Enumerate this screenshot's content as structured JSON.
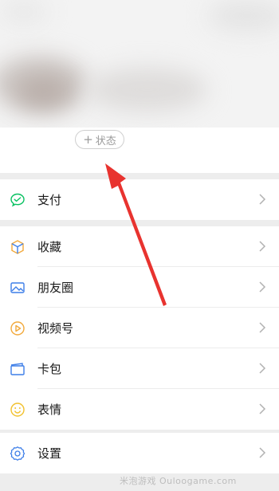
{
  "status": {
    "plus": "+",
    "label": "状态"
  },
  "groups": [
    {
      "items": [
        {
          "label": "支付",
          "icon": "pay-icon"
        }
      ]
    },
    {
      "items": [
        {
          "label": "收藏",
          "icon": "favorites-icon"
        },
        {
          "label": "朋友圈",
          "icon": "moments-icon"
        },
        {
          "label": "视频号",
          "icon": "channels-icon"
        },
        {
          "label": "卡包",
          "icon": "cards-icon"
        },
        {
          "label": "表情",
          "icon": "stickers-icon"
        }
      ]
    },
    {
      "items": [
        {
          "label": "设置",
          "icon": "settings-icon"
        }
      ]
    }
  ],
  "colors": {
    "pay": "#07c160",
    "favorites": "#f2a93b",
    "moments": "#3d7ee8",
    "channels": "#f2a93b",
    "cards": "#3d7ee8",
    "stickers": "#f2c12e",
    "settings": "#3d7ee8",
    "arrow": "#e8332f"
  },
  "watermark": "米泡游戏 Ouloogame.com"
}
